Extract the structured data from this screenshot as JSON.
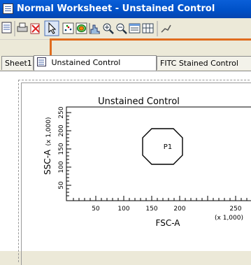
{
  "window": {
    "title": "Normal Worksheet - Unstained Control"
  },
  "toolbar": {
    "buttons": [
      "worksheet-icon",
      "print-icon",
      "delete-icon",
      "pointer-icon",
      "dot-plot-icon",
      "contour-plot-icon",
      "histogram-icon",
      "zoom-in-icon",
      "zoom-out-icon",
      "stats-view-icon",
      "grid-icon",
      "gate-icon"
    ],
    "selected": "pointer-icon"
  },
  "tabs": [
    {
      "label": "Sheet1",
      "active": false
    },
    {
      "label": "Unstained Control",
      "active": true
    },
    {
      "label": "FITC Stained Control",
      "active": false
    }
  ],
  "plot": {
    "title": "Unstained Control",
    "gate_label": "P1",
    "x_label": "FSC-A",
    "x_multiplier": "(x 1,000)",
    "y_label": "SSC-A",
    "y_multiplier": "(x 1,000)"
  },
  "chart_data": {
    "type": "scatter",
    "title": "Unstained Control",
    "xlabel": "FSC-A",
    "ylabel": "SSC-A",
    "x_ticks": [
      "50",
      "100",
      "150",
      "200",
      "250"
    ],
    "y_ticks": [
      "50",
      "100",
      "150",
      "200",
      "250"
    ],
    "gates": [
      {
        "name": "P1",
        "shape": "octagon"
      }
    ]
  },
  "colors": {
    "titlebar": "#0051c8",
    "highlight_border": "#e06c1e"
  }
}
